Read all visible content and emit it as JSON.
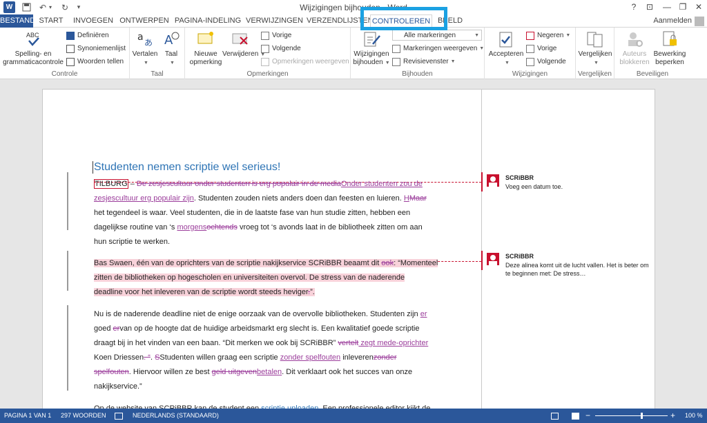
{
  "window": {
    "title": "Wijzigingen bijhouden - Word",
    "help": "?",
    "restore_ribbon": "⊡",
    "minimize": "—",
    "maximize": "❐",
    "close": "✕",
    "sign_in": "Aanmelden"
  },
  "quick_access": {
    "save_icon": "save-icon",
    "undo": "↶",
    "redo": "↻",
    "customize": "▾"
  },
  "tabs": [
    {
      "label": "BESTAND",
      "kind": "file"
    },
    {
      "label": "START"
    },
    {
      "label": "INVOEGEN"
    },
    {
      "label": "ONTWERPEN"
    },
    {
      "label": "PAGINA-INDELING"
    },
    {
      "label": "VERWIJZINGEN"
    },
    {
      "label": "VERZENDLIJSTEN"
    },
    {
      "label": "CONTROLEREN",
      "active": true
    },
    {
      "label": "BEELD"
    }
  ],
  "ribbon": {
    "controle": {
      "label": "Controle",
      "spelling": "Spelling- en grammaticacontrole",
      "define": "Definiëren",
      "thesaurus": "Synoniemenlijst",
      "wordcount": "Woorden tellen"
    },
    "taal": {
      "label": "Taal",
      "translate": "Vertalen",
      "language": "Taal"
    },
    "opmerkingen": {
      "label": "Opmerkingen",
      "new": "Nieuwe opmerking",
      "delete": "Verwijderen",
      "prev": "Vorige",
      "next": "Volgende",
      "show": "Opmerkingen weergeven"
    },
    "bijhouden": {
      "label": "Bijhouden",
      "track": "Wijzigingen bijhouden",
      "display_value": "Alle markeringen",
      "show_markup": "Markeringen weergeven",
      "pane": "Revisievenster"
    },
    "wijzigingen": {
      "label": "Wijzigingen",
      "accept": "Accepteren",
      "reject": "Negeren",
      "prev": "Vorige",
      "next": "Volgende"
    },
    "vergelijken": {
      "label": "Vergelijken",
      "compare": "Vergelijken"
    },
    "beveiligen": {
      "label": "Beveiligen",
      "block": "Auteurs blokkeren",
      "restrict": "Bewerking beperken"
    }
  },
  "document": {
    "heading": "Studenten nemen scriptie wel serieus!",
    "p1": {
      "l1": {
        "a": "TILBURG",
        "b": " – ",
        "del1": "De zesjescultuur onder studenten is erg populair in de media",
        "ins1": "Onder studenten zou de"
      },
      "l2": {
        "ins1": "zesjescultuur erg populair zijn",
        "a": ". Studenten zouden niets anders doen dan feesten en luieren. ",
        "ins2": "H",
        "del1": "Maar"
      },
      "l3": "het tegendeel is waar. Veel studenten, die in de laatste fase van hun studie zitten, hebben een",
      "l4": {
        "a": "dagelijkse routine van ‘s ",
        "ins1": "morgens",
        "del1": "ochtends",
        "b": " vroeg tot ‘s avonds laat in de bibliotheek zitten om aan"
      },
      "l5": "hun scriptie te werken."
    },
    "p2": {
      "l1": {
        "a": "Bas Swaen, één van de oprichters van de scriptie nakijkservice SCRiBBR beaamt dit ",
        "del1": "ook",
        "b": ": “Momenteel"
      },
      "l2": "zitten de bibliotheken op hogescholen en universiteiten overvol. De stress van de naderende",
      "l3": {
        "a": "deadline voor het inleveren van de scriptie wordt steeds heviger",
        "del1": ".",
        "b": "”."
      }
    },
    "p3": {
      "l1": {
        "a": "Nu is  de naderende deadline niet de enige oorzaak van de overvolle bibliotheken. Studenten zijn ",
        "ins1": "er"
      },
      "l2": {
        "a": "goed ",
        "del1": "er",
        "b": "van op de hoogte dat de huidige arbeidsmarkt erg slecht is.  Een kwalitatief goede scriptie"
      },
      "l3": {
        "a": "draagt bij in het vinden van een baan. “Dit merken we ook bij SCRiBBR” ",
        "del1": "vertelt",
        "ins1": " zegt mede-oprichter"
      },
      "l4": {
        "a": "Koen Driessen",
        "del1": ". “",
        "b": ". ",
        "del2": "S",
        "c": "Studenten willen graag een scriptie ",
        "ins1": "zonder spelfouten",
        "d": " inleveren",
        "del3": "zonder"
      },
      "l5": {
        "del1": "spelfouten",
        "b": ". Hiervoor willen ze best ",
        "del2": "geld uitgeven",
        "ins1": "betalen",
        "c": ". Dit verklaart ook het succes van onze"
      },
      "l6": "nakijkservice.”"
    },
    "p4": {
      "l1": {
        "a": "Op de website van SCRiBBR kan de student een ",
        "link1": "scriptie uploaden",
        "b": ". Een professionele editor kijkt de"
      }
    }
  },
  "comments": [
    {
      "author": "SCRiBBR",
      "text": "Voeg een datum toe."
    },
    {
      "author": "SCRiBBR",
      "text": "Deze alinea komt uit de lucht vallen. Het is beter om te beginnen met: De stress…"
    }
  ],
  "status": {
    "page": "PAGINA 1 VAN 1",
    "words": "297 WOORDEN",
    "language": "NEDERLANDS (STANDAARD)",
    "zoom": "100 %",
    "zoom_level": 1.0
  },
  "colors": {
    "accent": "#2b579a",
    "callout": "#1ba1e2",
    "markup": "#9b3d9b",
    "comment": "#c8102e"
  }
}
